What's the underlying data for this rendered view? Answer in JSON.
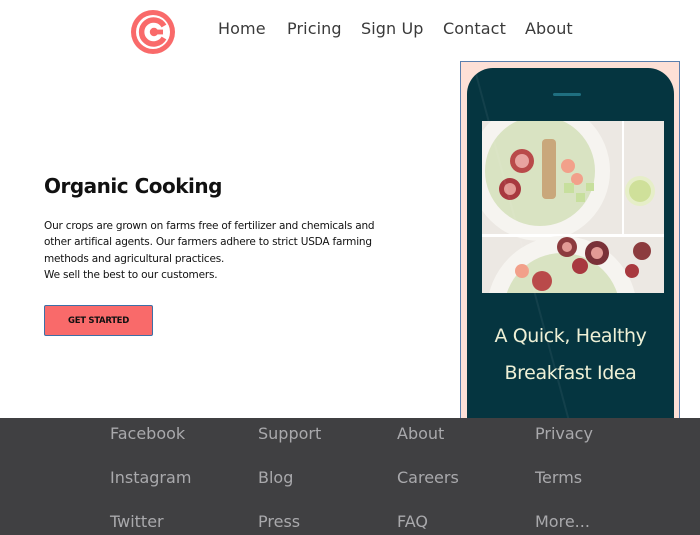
{
  "header": {
    "logo_icon": "brand-logo-icon",
    "nav": [
      "Home",
      "Pricing",
      "Sign Up",
      "Contact",
      "About"
    ]
  },
  "hero": {
    "title": "Organic Cooking",
    "body_lines": [
      "Our crops are grown on farms free of fertilizer and chemicals and",
      "other artifical agents.  Our farmers adhere to strict USDA farming",
      "methods and agricultural practices.",
      "We sell the best to our customers."
    ],
    "cta_label": "GET STARTED"
  },
  "phone": {
    "caption_line1": "A Quick, Healthy",
    "caption_line2": "Breakfast Idea"
  },
  "footer": {
    "columns": [
      [
        "Facebook",
        "Instagram",
        "Twitter"
      ],
      [
        "Support",
        "Blog",
        "Press"
      ],
      [
        "About",
        "Careers",
        "FAQ"
      ],
      [
        "Privacy",
        "Terms",
        "More..."
      ]
    ]
  },
  "colors": {
    "accent": "#f96a6a",
    "footer_bg": "#404042",
    "phone_bg": "#053540",
    "frame_bg": "#fde0d6"
  }
}
